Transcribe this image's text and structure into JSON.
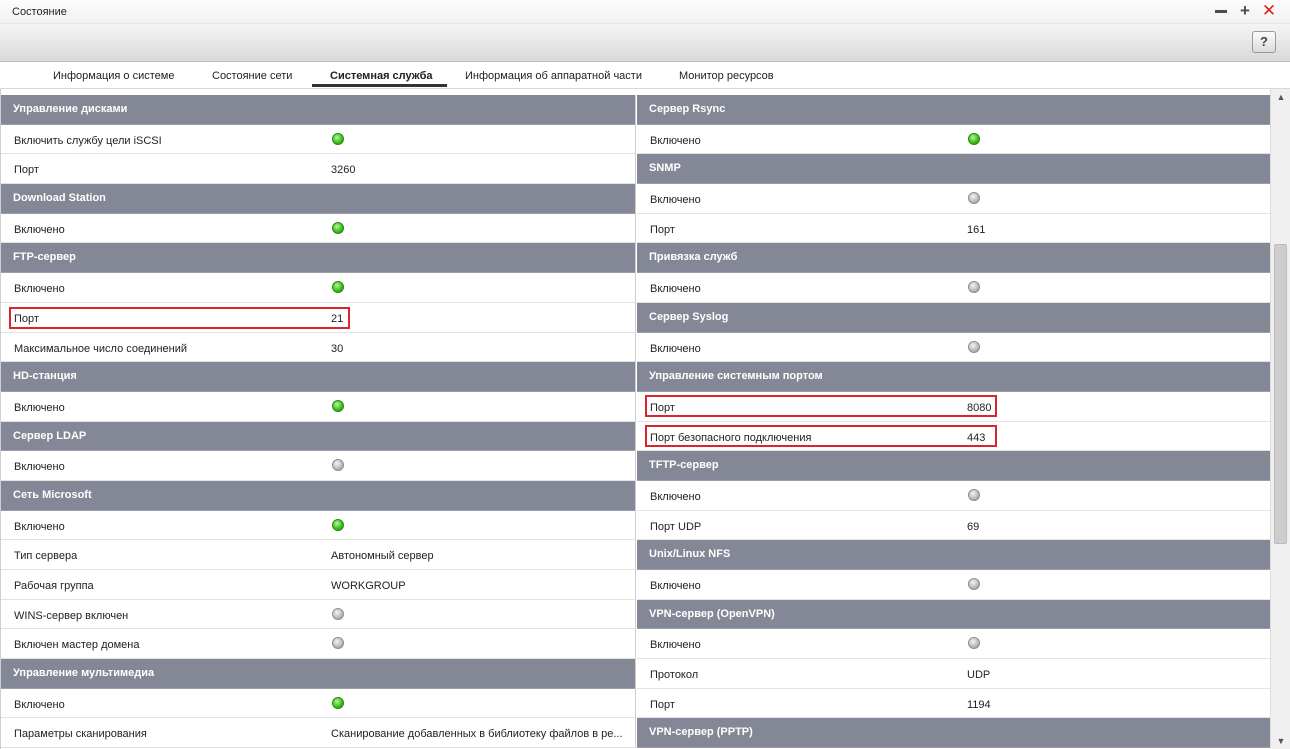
{
  "window": {
    "title": "Состояние"
  },
  "tabs": [
    {
      "label": "Информация о системе"
    },
    {
      "label": "Состояние сети"
    },
    {
      "label": "Системная служба"
    },
    {
      "label": "Информация об аппаратной части"
    },
    {
      "label": "Монитор ресурсов"
    }
  ],
  "help": {
    "label": "?"
  },
  "status_colors": {
    "on": "#3cc21b",
    "off": "#b8b8b8",
    "highlight": "#d9262e",
    "section_header": "#848896"
  },
  "left": [
    {
      "type": "head",
      "label": "Управление дисками"
    },
    {
      "type": "status",
      "label": "Включить службу цели iSCSI",
      "state": "on"
    },
    {
      "type": "value",
      "label": "Порт",
      "value": "3260"
    },
    {
      "type": "head",
      "label": "Download Station"
    },
    {
      "type": "status",
      "label": "Включено",
      "state": "on"
    },
    {
      "type": "head",
      "label": "FTP-сервер"
    },
    {
      "type": "status",
      "label": "Включено",
      "state": "on"
    },
    {
      "type": "value",
      "label": "Порт",
      "value": "21"
    },
    {
      "type": "value",
      "label": "Максимальное число соединений",
      "value": "30"
    },
    {
      "type": "head",
      "label": "HD-станция"
    },
    {
      "type": "status",
      "label": "Включено",
      "state": "on"
    },
    {
      "type": "head",
      "label": "Сервер LDAP"
    },
    {
      "type": "status",
      "label": "Включено",
      "state": "off"
    },
    {
      "type": "head",
      "label": "Сеть Microsoft"
    },
    {
      "type": "status",
      "label": "Включено",
      "state": "on"
    },
    {
      "type": "value",
      "label": "Тип сервера",
      "value": "Автономный сервер"
    },
    {
      "type": "value",
      "label": "Рабочая группа",
      "value": "WORKGROUP"
    },
    {
      "type": "status",
      "label": "WINS-сервер включен",
      "state": "off"
    },
    {
      "type": "status",
      "label": "Включен мастер домена",
      "state": "off"
    },
    {
      "type": "head",
      "label": "Управление мультимедиа"
    },
    {
      "type": "status",
      "label": "Включено",
      "state": "on"
    },
    {
      "type": "value",
      "label": "Параметры сканирования",
      "value": "Сканирование добавленных в библиотеку файлов в ре..."
    }
  ],
  "right": [
    {
      "type": "head",
      "label": "Сервер Rsync"
    },
    {
      "type": "status",
      "label": "Включено",
      "state": "on"
    },
    {
      "type": "head",
      "label": "SNMP"
    },
    {
      "type": "status",
      "label": "Включено",
      "state": "off"
    },
    {
      "type": "value",
      "label": "Порт",
      "value": "161"
    },
    {
      "type": "head",
      "label": "Привязка служб"
    },
    {
      "type": "status",
      "label": "Включено",
      "state": "off"
    },
    {
      "type": "head",
      "label": "Сервер Syslog"
    },
    {
      "type": "status",
      "label": "Включено",
      "state": "off"
    },
    {
      "type": "head",
      "label": "Управление системным портом"
    },
    {
      "type": "value",
      "label": "Порт",
      "value": "8080"
    },
    {
      "type": "value",
      "label": "Порт безопасного подключения",
      "value": "443"
    },
    {
      "type": "head",
      "label": "TFTP-сервер"
    },
    {
      "type": "status",
      "label": "Включено",
      "state": "off"
    },
    {
      "type": "value",
      "label": "Порт UDP",
      "value": "69"
    },
    {
      "type": "head",
      "label": "Unix/Linux NFS"
    },
    {
      "type": "status",
      "label": "Включено",
      "state": "off"
    },
    {
      "type": "head",
      "label": "VPN-сервер (OpenVPN)"
    },
    {
      "type": "status",
      "label": "Включено",
      "state": "off"
    },
    {
      "type": "value",
      "label": "Протокол",
      "value": "UDP"
    },
    {
      "type": "value",
      "label": "Порт",
      "value": "1194"
    },
    {
      "type": "head",
      "label": "VPN-сервер (PPTP)"
    }
  ]
}
